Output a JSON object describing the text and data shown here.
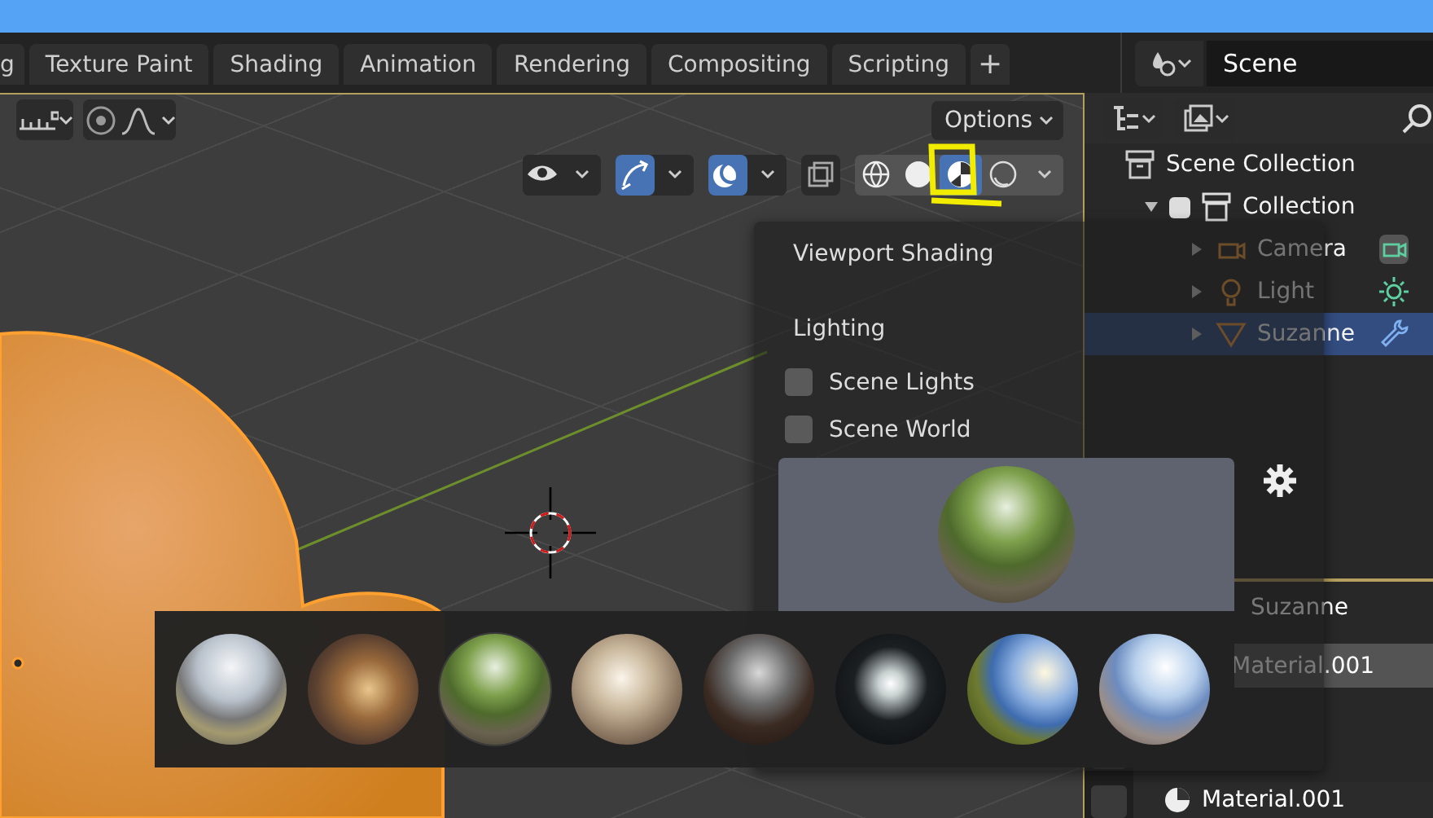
{
  "topbar": {
    "tabs": [
      {
        "label": "g",
        "selected": false
      },
      {
        "label": "Texture Paint",
        "selected": false
      },
      {
        "label": "Shading",
        "selected": false
      },
      {
        "label": "Animation",
        "selected": false
      },
      {
        "label": "Rendering",
        "selected": false
      },
      {
        "label": "Compositing",
        "selected": false
      },
      {
        "label": "Scripting",
        "selected": false
      }
    ],
    "add_tab": "+",
    "scene": "Scene"
  },
  "viewport": {
    "options": "Options",
    "shading_modes": [
      {
        "kind": "wireframe",
        "selected": false
      },
      {
        "kind": "solid",
        "selected": false
      },
      {
        "kind": "material",
        "selected": true
      },
      {
        "kind": "rendered",
        "selected": false
      }
    ]
  },
  "outliner": {
    "tree": [
      {
        "label": "Scene Collection",
        "kind": "scene",
        "selected": false,
        "children": [
          {
            "label": "Collection",
            "kind": "collection",
            "selected": false,
            "checked": true,
            "expanded": true,
            "children": [
              {
                "label": "Camera",
                "kind": "camera",
                "selected": false,
                "expanded": false
              },
              {
                "label": "Light",
                "kind": "light",
                "selected": false,
                "expanded": false
              },
              {
                "label": "Suzanne",
                "kind": "mesh",
                "selected": true,
                "expanded": false
              }
            ]
          }
        ]
      }
    ]
  },
  "shading_popover": {
    "title": "Viewport Shading",
    "section": "Lighting",
    "options": [
      {
        "label": "Scene Lights",
        "checked": false
      },
      {
        "label": "Scene World",
        "checked": false
      }
    ],
    "preview": {
      "kind": "forest"
    }
  },
  "hdri_picker": {
    "items": [
      {
        "kind": "city",
        "selected": false
      },
      {
        "kind": "courtyard",
        "selected": false
      },
      {
        "kind": "forest",
        "selected": true
      },
      {
        "kind": "interior",
        "selected": false
      },
      {
        "kind": "night",
        "selected": false
      },
      {
        "kind": "tunnel",
        "selected": false
      },
      {
        "kind": "field",
        "selected": false
      },
      {
        "kind": "street",
        "selected": false
      }
    ]
  },
  "properties": {
    "object": "Suzanne",
    "material_slot": "Material.001",
    "material": "Material.001"
  }
}
